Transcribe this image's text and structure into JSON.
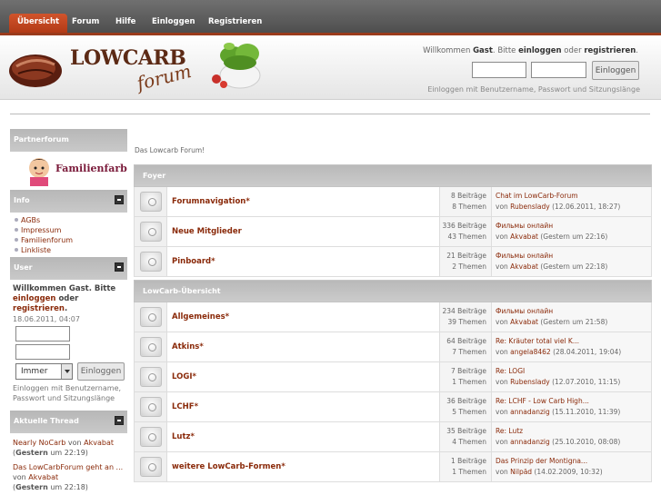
{
  "nav": {
    "tabs": [
      {
        "label": "Übersicht",
        "active": true
      },
      {
        "label": "Forum"
      },
      {
        "label": "Hilfe"
      },
      {
        "label": "Einloggen"
      },
      {
        "label": "Registrieren"
      }
    ]
  },
  "header": {
    "logo_main": "LOWCARB",
    "logo_sub": "forum",
    "welcome_prefix": "Willkommen",
    "welcome_guest": "Gast",
    "welcome_mid": ". Bitte",
    "welcome_login": "einloggen",
    "welcome_or": "oder",
    "welcome_register": "registrieren",
    "welcome_end": ".",
    "login_button": "Einloggen",
    "login_hint": "Einloggen mit Benutzername, Passwort und Sitzungslänge"
  },
  "sidebar": {
    "partner_title": "Partnerforum",
    "partner_logo": "Familienfarben",
    "info_title": "Info",
    "info_links": [
      "AGBs",
      "Impressum",
      "Familienforum",
      "Linkliste"
    ],
    "user_title": "User",
    "user_welcome": "Willkommen Gast. Bitte",
    "user_login": "einloggen",
    "user_or": "oder",
    "user_register": "registrieren",
    "user_end": ".",
    "user_date": "18.06.2011, 04:07",
    "duration_select": "Immer",
    "login_button": "Einloggen",
    "login_hint": "Einloggen mit Benutzername, Passwort und Sitzungslänge",
    "thread_title": "Aktuelle Thread",
    "threads": [
      {
        "title": "Nearly NoCarb",
        "von": "von",
        "author": "Akvabat",
        "time_bold": "Gestern",
        "time": "um 22:19"
      },
      {
        "title": "Das LowCarbForum geht an ...",
        "von": "von",
        "author": "Akvabat",
        "time_bold": "Gestern",
        "time": "um 22:18"
      }
    ]
  },
  "main": {
    "breadcrumb": "Das Lowcarb Forum!",
    "categories": [
      {
        "title": "Foyer",
        "forums": [
          {
            "name": "Forumnavigation*",
            "posts": "8 Beiträge",
            "topics": "8 Themen",
            "last_title": "Chat im LowCarb-Forum",
            "von": "von",
            "last_author": "Rubenslady",
            "last_time": "(12.06.2011, 18:27)"
          },
          {
            "name": "Neue Mitglieder",
            "posts": "336 Beiträge",
            "topics": "43 Themen",
            "last_title": "Фильмы онлайн",
            "von": "von",
            "last_author": "Akvabat",
            "last_time": "(Gestern um 22:16)"
          },
          {
            "name": "Pinboard*",
            "posts": "21 Beiträge",
            "topics": "2 Themen",
            "last_title": "Фильмы онлайн",
            "von": "von",
            "last_author": "Akvabat",
            "last_time": "(Gestern um 22:18)"
          }
        ]
      },
      {
        "title": "LowCarb-Übersicht",
        "forums": [
          {
            "name": "Allgemeines*",
            "posts": "234 Beiträge",
            "topics": "39 Themen",
            "last_title": "Фильмы онлайн",
            "von": "von",
            "last_author": "Akvabat",
            "last_time": "(Gestern um 21:58)"
          },
          {
            "name": "Atkins*",
            "posts": "64 Beiträge",
            "topics": "7 Themen",
            "last_title": "Re: Kräuter total viel K...",
            "von": "von",
            "last_author": "angela8462",
            "last_time": "(28.04.2011, 19:04)"
          },
          {
            "name": "LOGI*",
            "posts": "7 Beiträge",
            "topics": "1 Themen",
            "last_title": "Re: LOGI",
            "von": "von",
            "last_author": "Rubenslady",
            "last_time": "(12.07.2010, 11:15)"
          },
          {
            "name": "LCHF*",
            "posts": "36 Beiträge",
            "topics": "5 Themen",
            "last_title": "Re: LCHF - Low Carb High...",
            "von": "von",
            "last_author": "annadanzig",
            "last_time": "(15.11.2010, 11:39)"
          },
          {
            "name": "Lutz*",
            "posts": "35 Beiträge",
            "topics": "4 Themen",
            "last_title": "Re: Lutz",
            "von": "von",
            "last_author": "annadanzig",
            "last_time": "(25.10.2010, 08:08)"
          },
          {
            "name": "weitere LowCarb-Formen*",
            "posts": "1 Beiträge",
            "topics": "1 Themen",
            "last_title": "Das Prinzip der Montigna...",
            "von": "von",
            "last_author": "Nilpäd",
            "last_time": "(14.02.2009, 10:32)"
          }
        ]
      }
    ]
  },
  "colors": {
    "active_tab": "#c84a22",
    "accent_line": "#9a3b1c",
    "link": "#8a2a0a",
    "header_band": "#b9b9b9"
  }
}
